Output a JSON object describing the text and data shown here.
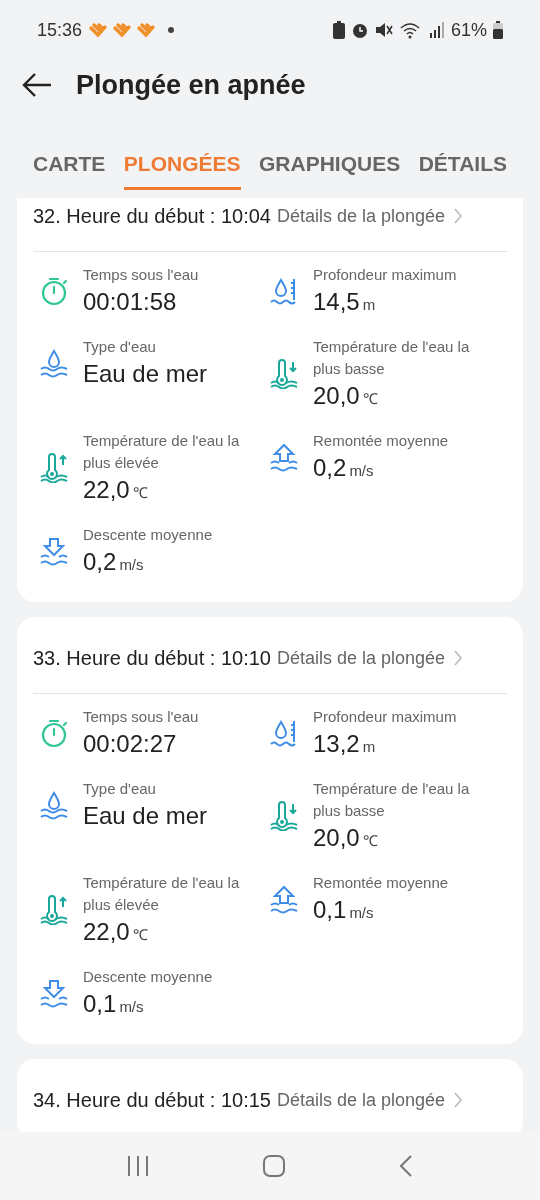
{
  "status_bar": {
    "time": "15:36",
    "battery": "61%"
  },
  "header": {
    "title": "Plongée en apnée"
  },
  "tabs": [
    {
      "label": "CARTE",
      "selected": false
    },
    {
      "label": "PLONGÉES",
      "selected": true
    },
    {
      "label": "GRAPHIQUES",
      "selected": false
    },
    {
      "label": "DÉTAILS",
      "selected": false
    }
  ],
  "dives": [
    {
      "title": "32. Heure du début : 10:04",
      "link": "Détails de la plongée",
      "stats": [
        {
          "kind": "stopwatch",
          "label": "Temps sous l'eau",
          "value": "00:01:58"
        },
        {
          "kind": "depth",
          "label": "Profondeur maximum",
          "value": "14,5",
          "unit": "m"
        },
        {
          "kind": "drop",
          "label": "Type d'eau",
          "value": "Eau de mer"
        },
        {
          "kind": "temp-low",
          "label": "Température de l'eau la plus basse",
          "value": "20,0",
          "unit": "℃"
        },
        {
          "kind": "temp-high",
          "label": "Température de l'eau la plus élevée",
          "value": "22,0",
          "unit": "℃"
        },
        {
          "kind": "ascent",
          "label": "Remontée moyenne",
          "value": "0,2",
          "unit": "m/s"
        },
        {
          "kind": "descent",
          "label": "Descente moyenne",
          "value": "0,2",
          "unit": "m/s"
        }
      ]
    },
    {
      "title": "33. Heure du début : 10:10",
      "link": "Détails de la plongée",
      "stats": [
        {
          "kind": "stopwatch",
          "label": "Temps sous l'eau",
          "value": "00:02:27"
        },
        {
          "kind": "depth",
          "label": "Profondeur maximum",
          "value": "13,2",
          "unit": "m"
        },
        {
          "kind": "drop",
          "label": "Type d'eau",
          "value": "Eau de mer"
        },
        {
          "kind": "temp-low",
          "label": "Température de l'eau la plus basse",
          "value": "20,0",
          "unit": "℃"
        },
        {
          "kind": "temp-high",
          "label": "Température de l'eau la plus élevée",
          "value": "22,0",
          "unit": "℃"
        },
        {
          "kind": "ascent",
          "label": "Remontée moyenne",
          "value": "0,1",
          "unit": "m/s"
        },
        {
          "kind": "descent",
          "label": "Descente moyenne",
          "value": "0,1",
          "unit": "m/s"
        }
      ]
    },
    {
      "title": "34. Heure du début : 10:15",
      "link": "Détails de la plongée"
    }
  ]
}
